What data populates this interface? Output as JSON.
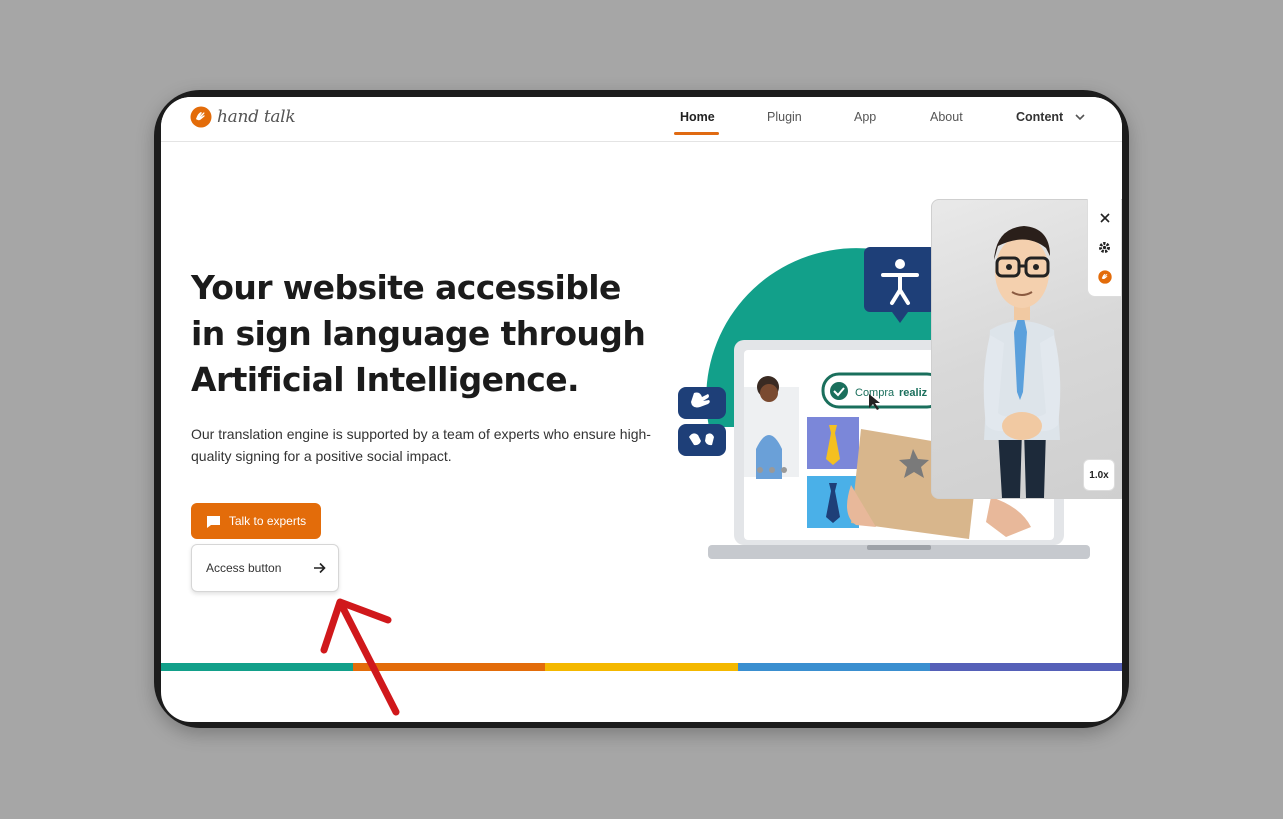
{
  "brand": {
    "name": "hand talk",
    "color": "#e36c0a"
  },
  "nav": {
    "items": [
      {
        "label": "Home",
        "active": true
      },
      {
        "label": "Plugin",
        "active": false
      },
      {
        "label": "App",
        "active": false
      },
      {
        "label": "About",
        "active": false
      },
      {
        "label": "Content",
        "active": false,
        "has_dropdown": true
      }
    ]
  },
  "hero": {
    "title": "Your website accessible in sign language through Artificial Intelligence.",
    "subtitle": "Our translation engine is supported by a team of experts who ensure high-quality signing for a positive social impact.",
    "primary_button": "Talk to experts",
    "secondary_button": "Access button"
  },
  "illustration": {
    "banner_text_a": "Compra",
    "banner_text_b": "realiz"
  },
  "widget": {
    "close_icon": "close-icon",
    "settings_icon": "gear-icon",
    "speed": "1.0x"
  },
  "colors": {
    "accent": "#e36c0a",
    "teal": "#12a08a",
    "navy": "#1e3f78",
    "stripe": [
      "#12a08a",
      "#e36c0a",
      "#f4b800",
      "#3a8fd0",
      "#5560b8"
    ],
    "annotation_arrow": "#d0181b"
  }
}
